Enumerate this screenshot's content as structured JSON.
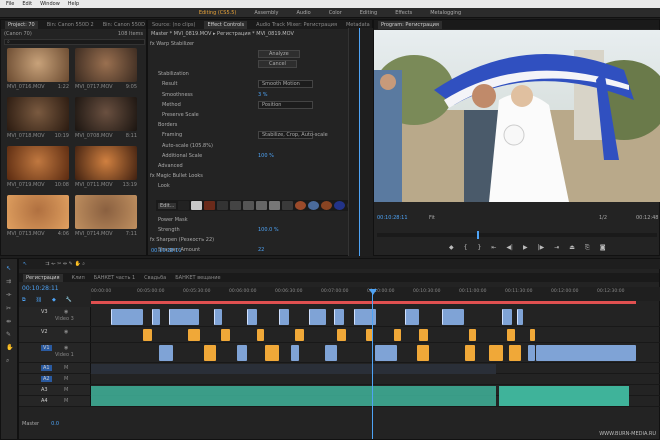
{
  "menu": [
    "File",
    "Edit",
    "Window",
    "Help"
  ],
  "workspaces": [
    {
      "label": "Editing (CS5.5)",
      "active": true
    },
    {
      "label": "Assembly"
    },
    {
      "label": "Audio"
    },
    {
      "label": "Color"
    },
    {
      "label": "Editing"
    },
    {
      "label": "Effects"
    },
    {
      "label": "Metalogging"
    }
  ],
  "project": {
    "tabs": [
      "Project: 70",
      "Bin: Canon 550D 2",
      "Bin: Canon 550D"
    ],
    "path": "(Canon 70)",
    "count": "108 Items",
    "thumbs": [
      {
        "name": "MVI_0716.MOV",
        "dur": "1:22",
        "c1": "#c8a27a",
        "c2": "#6a4a30"
      },
      {
        "name": "MVI_0717.MOV",
        "dur": "9:05",
        "c1": "#9a7050",
        "c2": "#3a2a20"
      },
      {
        "name": "MVI_0718.MOV",
        "dur": "10:19",
        "c1": "#7a5a40",
        "c2": "#2a1a10"
      },
      {
        "name": "MVI_0708.MOV",
        "dur": "8:11",
        "c1": "#6a5040",
        "c2": "#1a1410"
      },
      {
        "name": "MVI_0719.MOV",
        "dur": "10:08",
        "c1": "#c07840",
        "c2": "#5a2a10"
      },
      {
        "name": "MVI_0711.MOV",
        "dur": "13:19",
        "c1": "#d08040",
        "c2": "#402010"
      },
      {
        "name": "MVI_0713.MOV",
        "dur": "4:06",
        "c1": "#b07040",
        "c2": "#e0a060"
      },
      {
        "name": "MVI_0714.MOV",
        "dur": "7:11",
        "c1": "#8a6040",
        "c2": "#c09060"
      }
    ]
  },
  "effects": {
    "tabs": [
      "Source: (no clips)",
      "Effect Controls",
      "Audio Track Mixer: Регистрация",
      "Metadata"
    ],
    "breadcrumb": "Master * MVI_0819.MOV ▸ Регистрация * MVI_0819.MOV",
    "rows": [
      {
        "label": "fx  Warp Stabilizer",
        "value": "",
        "indent": 2
      },
      {
        "label": "",
        "value": "Analyze",
        "indent": 0,
        "button": true
      },
      {
        "label": "",
        "value": "Cancel",
        "indent": 0,
        "button": true
      },
      {
        "label": "Stabilization",
        "value": "",
        "indent": 10
      },
      {
        "label": "Result",
        "value": "Smooth Motion",
        "indent": 14,
        "drop": true
      },
      {
        "label": "Smoothness",
        "value": "3 %",
        "indent": 14,
        "blue": true
      },
      {
        "label": "Method",
        "value": "Position",
        "indent": 14,
        "drop": true
      },
      {
        "label": "Preserve Scale",
        "value": "",
        "indent": 14
      },
      {
        "label": "Borders",
        "value": "",
        "indent": 10
      },
      {
        "label": "Framing",
        "value": "Stabilize, Crop, Auto-scale",
        "indent": 14,
        "drop": true
      },
      {
        "label": "Auto-scale (105.8%)",
        "value": "",
        "indent": 14
      },
      {
        "label": "Additional Scale",
        "value": "100 %",
        "indent": 14,
        "blue": true
      },
      {
        "label": "Advanced",
        "value": "",
        "indent": 10
      },
      {
        "label": "fx  Magic Bullet Looks",
        "value": "",
        "indent": 2
      },
      {
        "label": "Look",
        "value": "",
        "indent": 10
      }
    ],
    "rows2": [
      {
        "label": "Power Mask",
        "value": "",
        "indent": 10
      },
      {
        "label": "Strength",
        "value": "100.0 %",
        "indent": 10,
        "blue": true
      },
      {
        "label": "fx  Sharpen (Резкость 22)",
        "value": "",
        "indent": 2
      },
      {
        "label": "Sharpen Amount",
        "value": "22",
        "indent": 10,
        "blue": true
      }
    ],
    "edit_label": "Edit...",
    "timecode": "00:10:28:11"
  },
  "program": {
    "tabs": [
      "Program: Регистрация"
    ],
    "timecode": "00:10:28:11",
    "fit": "Fit",
    "scale": "1/2",
    "end_timecode": "00:12:48"
  },
  "timeline": {
    "tabs": [
      "Регистрация",
      "Клип",
      "БАНКЕТ часть 1",
      "Свадьба",
      "БАНКЕТ вещание"
    ],
    "timecode": "00:10:28:11",
    "ruler": [
      "00:00:00",
      "00:05:00:00",
      "00:05:30:00",
      "00:06:00:00",
      "00:06:30:00",
      "00:07:00:00",
      "00:10:00:00",
      "00:10:30:00",
      "00:11:00:00",
      "00:11:30:00",
      "00:12:00:00",
      "00:12:30:00"
    ],
    "tracks": [
      {
        "id": "V3",
        "name": "Video 3"
      },
      {
        "id": "V2",
        "name": ""
      },
      {
        "id": "V1",
        "name": "Video 1"
      },
      {
        "id": "A1",
        "name": ""
      },
      {
        "id": "A2",
        "name": ""
      },
      {
        "id": "A3",
        "name": ""
      },
      {
        "id": "A4",
        "name": ""
      }
    ],
    "master_label": "Master",
    "master_value": "0.0"
  },
  "watermark": "WWW.BURN-MEDIA.RU",
  "colors": {
    "accent": "#e8a33a",
    "blue": "#4ea3f5",
    "clip_blue": "#7fa3d6",
    "clip_yellow": "#f0a838",
    "audio": "#3fb39a",
    "playhead": "#4ea3f5"
  }
}
